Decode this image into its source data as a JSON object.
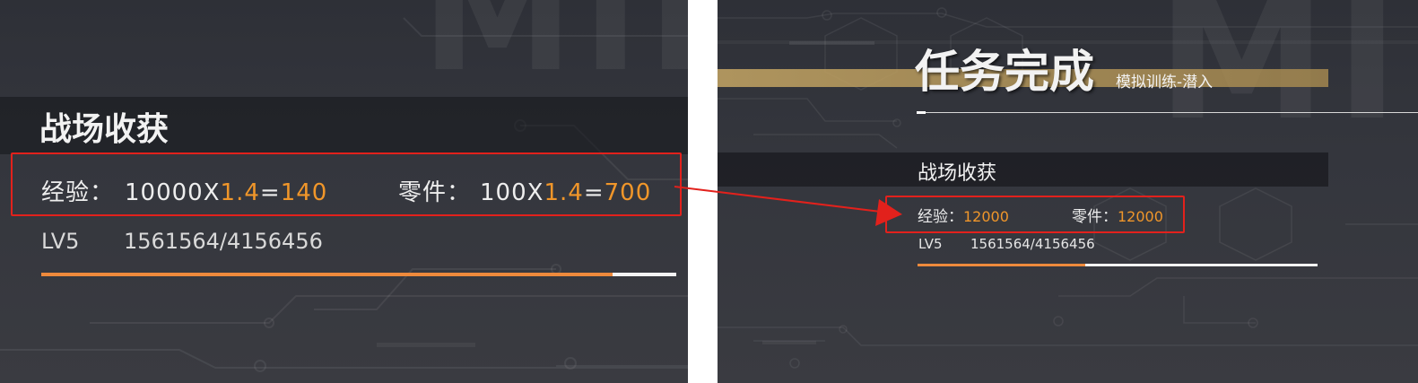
{
  "left_panel": {
    "watermark": "MII",
    "section_title": "战场收获",
    "exp_label": "经验：",
    "exp_base": "10000X",
    "exp_mult": "1.4",
    "exp_eq": "=",
    "exp_result": "140",
    "parts_label": "零件：",
    "parts_base": "100X",
    "parts_mult": "1.4",
    "parts_eq": "=",
    "parts_result": "700",
    "level": "LV5",
    "progress_text": "1561564/4156456",
    "progress_fraction": 0.9
  },
  "right_panel": {
    "watermark": "MII",
    "main_title": "任务完成",
    "subtitle": "模拟训练-潜入",
    "section_title": "战场收获",
    "exp_label": "经验：",
    "exp_value": "12000",
    "parts_label": "零件：",
    "parts_value": "12000",
    "level": "LV5",
    "progress_text": "1561564/4156456",
    "progress_fraction": 0.42
  },
  "colors": {
    "accent_orange": "#f0962a",
    "progress_orange": "#ee8a3c",
    "highlight_red": "#e2211c",
    "gold_bar": "#c4a564",
    "panel_bg": "#34363d"
  },
  "icons": [
    "arrow-right-icon"
  ]
}
